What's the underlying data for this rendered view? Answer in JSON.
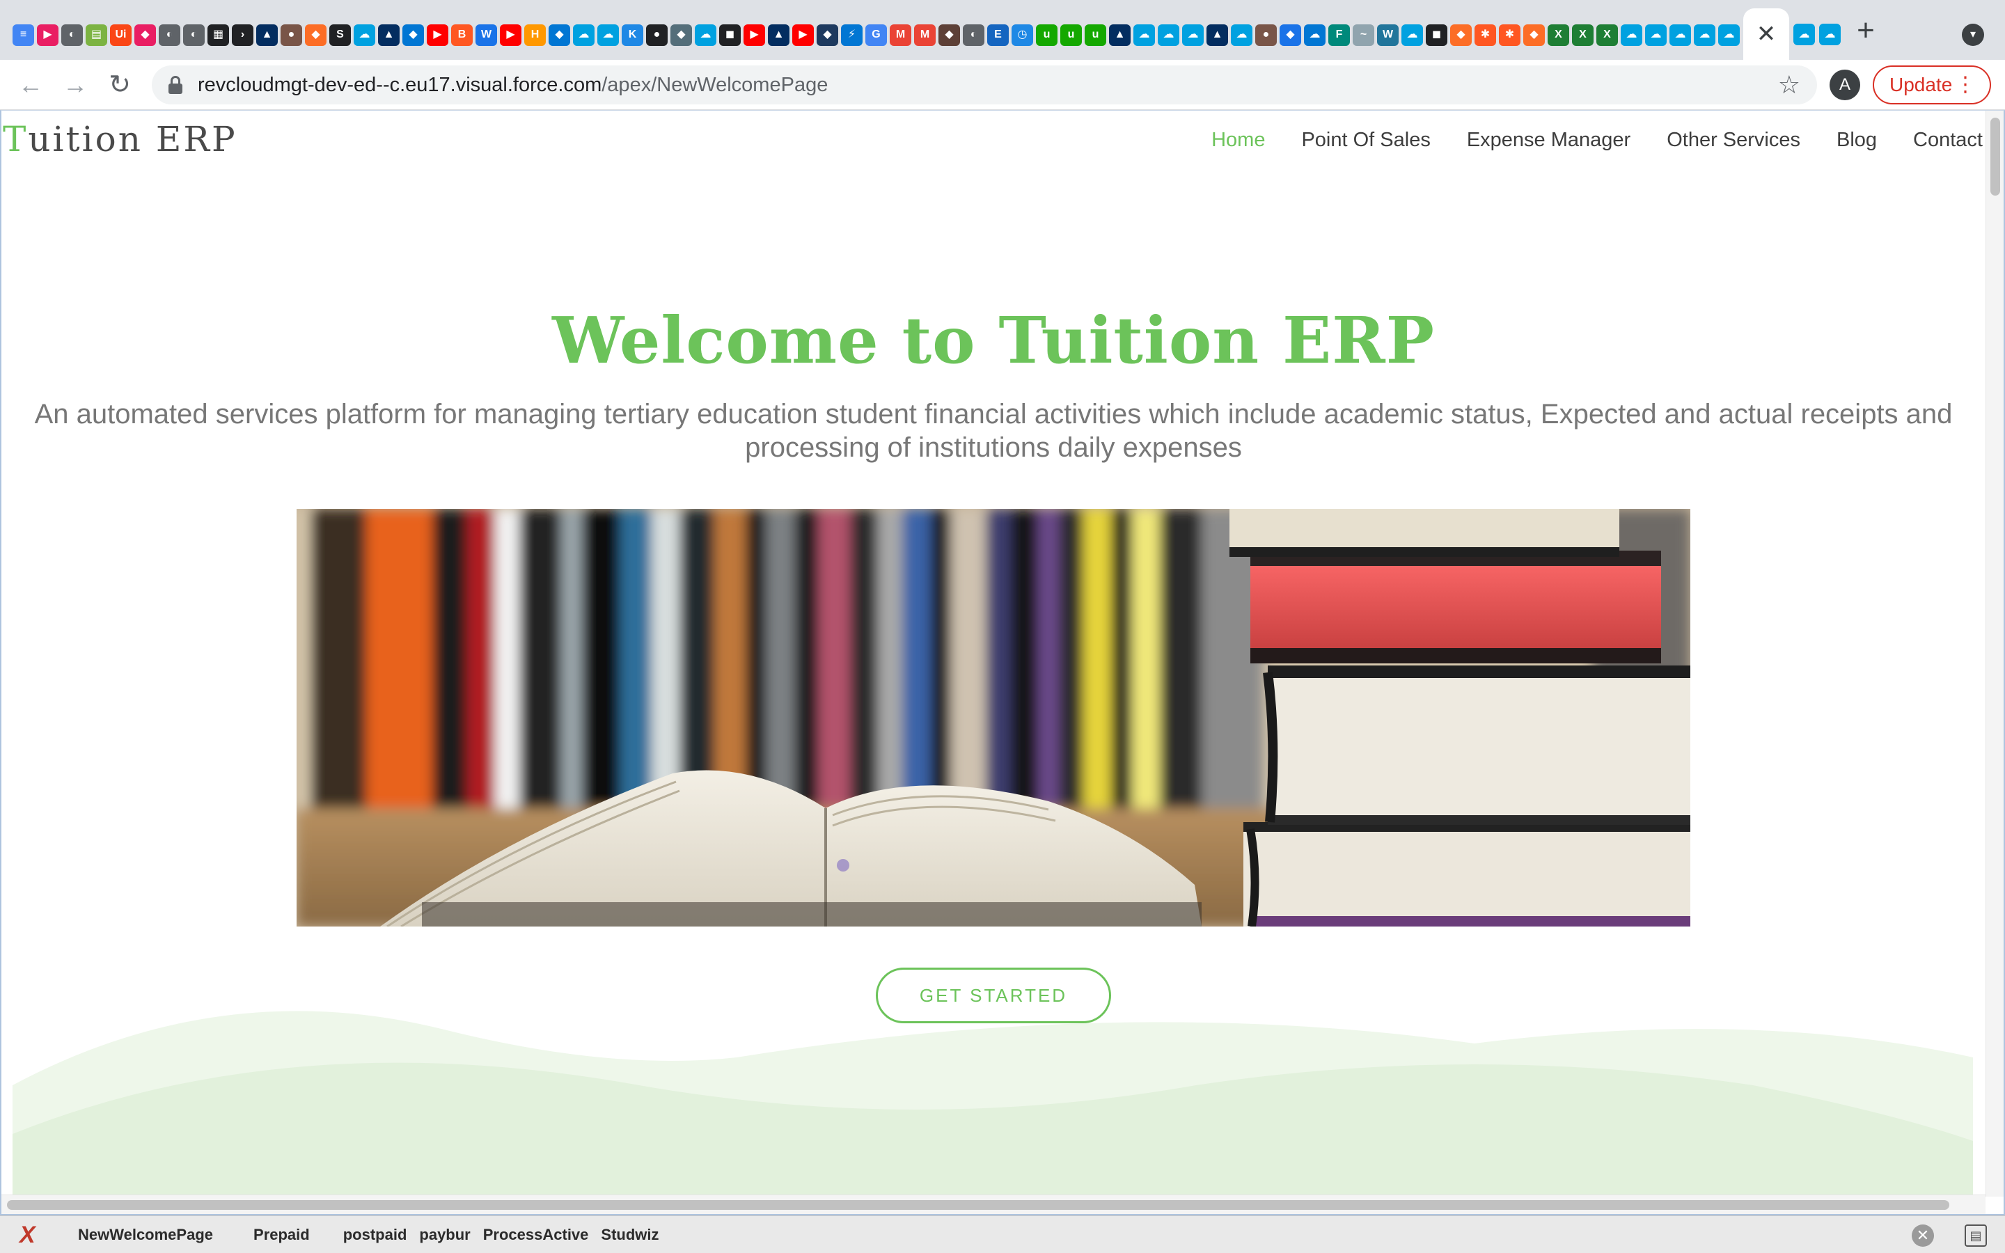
{
  "browser": {
    "tab_icons": [
      {
        "name": "docs-icon",
        "color": "#4285f4",
        "glyph": "≡"
      },
      {
        "name": "app-icon",
        "color": "#e91e63",
        "glyph": "▶"
      },
      {
        "name": "globe-icon",
        "color": "#5f6368",
        "glyph": "◐"
      },
      {
        "name": "sheet-icon",
        "color": "#7cb342",
        "glyph": "▤"
      },
      {
        "name": "uipath-icon",
        "color": "#fa4616",
        "glyph": "Ui"
      },
      {
        "name": "app-icon",
        "color": "#e91e63",
        "glyph": "◆"
      },
      {
        "name": "globe-icon",
        "color": "#5f6368",
        "glyph": "◐"
      },
      {
        "name": "globe-icon",
        "color": "#5f6368",
        "glyph": "◐"
      },
      {
        "name": "calendar-icon",
        "color": "#202124",
        "glyph": "▦"
      },
      {
        "name": "terminal-icon",
        "color": "#202124",
        "glyph": "›"
      },
      {
        "name": "trailhead-icon",
        "color": "#032d60",
        "glyph": "▲"
      },
      {
        "name": "avatar-icon",
        "color": "#795548",
        "glyph": "●"
      },
      {
        "name": "gitlab-icon",
        "color": "#fc6d26",
        "glyph": "◆"
      },
      {
        "name": "scribd-icon",
        "color": "#202124",
        "glyph": "S"
      },
      {
        "name": "salesforce-icon",
        "color": "#00a1e0",
        "glyph": "☁"
      },
      {
        "name": "trailhead-icon",
        "color": "#032d60",
        "glyph": "▲"
      },
      {
        "name": "app-icon",
        "color": "#0176d3",
        "glyph": "◆"
      },
      {
        "name": "youtube-icon",
        "color": "#ff0000",
        "glyph": "▶"
      },
      {
        "name": "blogger-icon",
        "color": "#ff5722",
        "glyph": "B"
      },
      {
        "name": "w-icon",
        "color": "#1a73e8",
        "glyph": "W"
      },
      {
        "name": "youtube-icon",
        "color": "#ff0000",
        "glyph": "▶"
      },
      {
        "name": "hi-icon",
        "color": "#ff9800",
        "glyph": "H"
      },
      {
        "name": "app-icon",
        "color": "#0176d3",
        "glyph": "◆"
      },
      {
        "name": "salesforce-icon",
        "color": "#00a1e0",
        "glyph": "☁"
      },
      {
        "name": "salesforce-icon",
        "color": "#00a1e0",
        "glyph": "☁"
      },
      {
        "name": "ktc-icon",
        "color": "#1e88e5",
        "glyph": "K"
      },
      {
        "name": "github-icon",
        "color": "#202124",
        "glyph": "●"
      },
      {
        "name": "app-icon",
        "color": "#546e7a",
        "glyph": "◆"
      },
      {
        "name": "salesforce-icon",
        "color": "#00a1e0",
        "glyph": "☁"
      },
      {
        "name": "app-icon",
        "color": "#202124",
        "glyph": "◼"
      },
      {
        "name": "youtube-icon",
        "color": "#ff0000",
        "glyph": "▶"
      },
      {
        "name": "trailhead-icon",
        "color": "#032d60",
        "glyph": "▲"
      },
      {
        "name": "youtube-icon",
        "color": "#ff0000",
        "glyph": "▶"
      },
      {
        "name": "app-icon",
        "color": "#1e3a5f",
        "glyph": "◆"
      },
      {
        "name": "bolt-icon",
        "color": "#0176d3",
        "glyph": "⚡"
      },
      {
        "name": "google-icon",
        "color": "#4285f4",
        "glyph": "G"
      },
      {
        "name": "gmail-icon",
        "color": "#ea4335",
        "glyph": "M"
      },
      {
        "name": "gmail-icon",
        "color": "#ea4335",
        "glyph": "M"
      },
      {
        "name": "app-icon",
        "color": "#5d4037",
        "glyph": "◆"
      },
      {
        "name": "globe-icon",
        "color": "#5f6368",
        "glyph": "◐"
      },
      {
        "name": "ed-icon",
        "color": "#1565c0",
        "glyph": "E"
      },
      {
        "name": "clock-icon",
        "color": "#1e88e5",
        "glyph": "◷"
      },
      {
        "name": "upwork-icon",
        "color": "#14a800",
        "glyph": "u"
      },
      {
        "name": "upwork-icon",
        "color": "#14a800",
        "glyph": "u"
      },
      {
        "name": "upwork-icon",
        "color": "#14a800",
        "glyph": "u"
      },
      {
        "name": "trailhead-icon",
        "color": "#032d60",
        "glyph": "▲"
      },
      {
        "name": "salesforce-icon",
        "color": "#00a1e0",
        "glyph": "☁"
      },
      {
        "name": "salesforce-icon",
        "color": "#00a1e0",
        "glyph": "☁"
      },
      {
        "name": "salesforce-icon",
        "color": "#00a1e0",
        "glyph": "☁"
      },
      {
        "name": "trailhead-icon",
        "color": "#032d60",
        "glyph": "▲"
      },
      {
        "name": "salesforce-icon",
        "color": "#00a1e0",
        "glyph": "☁"
      },
      {
        "name": "avatar-icon",
        "color": "#795548",
        "glyph": "●"
      },
      {
        "name": "diamond-icon",
        "color": "#1a73e8",
        "glyph": "◆"
      },
      {
        "name": "cloud-icon",
        "color": "#0176d3",
        "glyph": "☁"
      },
      {
        "name": "f-icon",
        "color": "#00897b",
        "glyph": "F"
      },
      {
        "name": "wave-icon",
        "color": "#90a4ae",
        "glyph": "~"
      },
      {
        "name": "wordpress-icon",
        "color": "#21759b",
        "glyph": "W"
      },
      {
        "name": "salesforce-icon",
        "color": "#00a1e0",
        "glyph": "☁"
      },
      {
        "name": "app-icon",
        "color": "#202124",
        "glyph": "◼"
      },
      {
        "name": "gitlab-icon",
        "color": "#fc6d26",
        "glyph": "◆"
      },
      {
        "name": "gear-icon",
        "color": "#ff5722",
        "glyph": "✱"
      },
      {
        "name": "gear-icon",
        "color": "#ff5722",
        "glyph": "✱"
      },
      {
        "name": "gitlab-icon",
        "color": "#fc6d26",
        "glyph": "◆"
      },
      {
        "name": "excel-icon",
        "color": "#1e7e34",
        "glyph": "X"
      },
      {
        "name": "excel-icon",
        "color": "#1e7e34",
        "glyph": "X"
      },
      {
        "name": "excel-icon",
        "color": "#1e7e34",
        "glyph": "X"
      },
      {
        "name": "salesforce-icon",
        "color": "#00a1e0",
        "glyph": "☁"
      },
      {
        "name": "salesforce-icon",
        "color": "#00a1e0",
        "glyph": "☁"
      },
      {
        "name": "salesforce-icon",
        "color": "#00a1e0",
        "glyph": "☁"
      },
      {
        "name": "salesforce-icon",
        "color": "#00a1e0",
        "glyph": "☁"
      },
      {
        "name": "salesforce-icon",
        "color": "#00a1e0",
        "glyph": "☁"
      }
    ],
    "active_tab": {
      "close_icon": "close-icon",
      "close_glyph": "✕"
    },
    "more_tab_icons": [
      {
        "name": "salesforce-icon",
        "color": "#00a1e0",
        "glyph": "☁"
      },
      {
        "name": "salesforce-icon",
        "color": "#00a1e0",
        "glyph": "☁"
      }
    ],
    "new_tab_glyph": "+",
    "tab_search_glyph": "▾",
    "back_glyph": "←",
    "forward_glyph": "→",
    "reload_glyph": "↻",
    "url_host": "revcloudmgt-dev-ed--c.eu17.visual.force.com",
    "url_path": "/apex/NewWelcomePage",
    "star_glyph": "☆",
    "avatar_letter": "A",
    "update_label": "Update",
    "update_menu_glyph": "⋮"
  },
  "site": {
    "brand_first": "T",
    "brand_rest": "uition ERP",
    "nav": [
      {
        "label": "Home",
        "active": true
      },
      {
        "label": "Point Of Sales",
        "active": false
      },
      {
        "label": "Expense Manager",
        "active": false
      },
      {
        "label": "Other Services",
        "active": false
      },
      {
        "label": "Blog",
        "active": false
      },
      {
        "label": "Contact",
        "active": false
      }
    ],
    "hero_title": "Welcome to Tuition ERP",
    "hero_subtitle": "An automated services platform for managing tertiary education student financial activities which include academic status, Expected and actual receipts and processing of institutions daily expenses",
    "cta_label": "GET STARTED",
    "accent_color": "#6cc35a"
  },
  "bottom_bar": {
    "logo_glyph": "X",
    "items": [
      "NewWelcomePage",
      "Prepaid",
      "postpaid",
      "paybur",
      "ProcessActive",
      "Studwiz"
    ],
    "close_glyph": "✕",
    "menu_glyph": "▤"
  }
}
